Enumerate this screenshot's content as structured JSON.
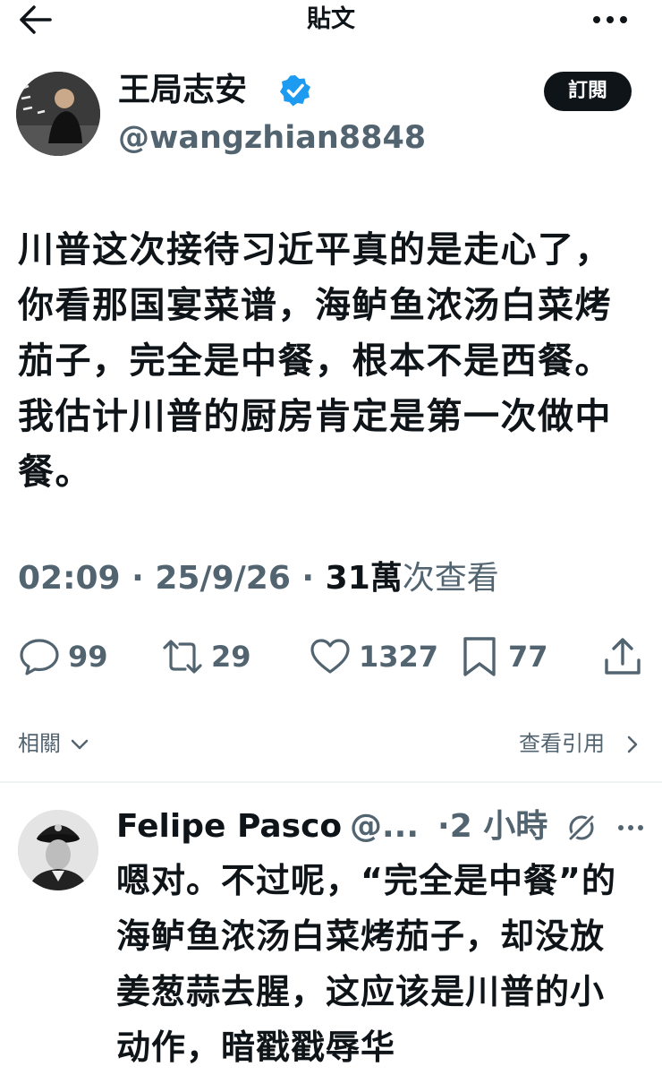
{
  "header": {
    "title": "貼文"
  },
  "post": {
    "author_name": "王局志安",
    "author_handle": "@wangzhian8848",
    "subscribe_label": "訂閱",
    "text": "川普这次接待习近平真的是走心了，你看那国宴菜谱，海鲈鱼浓汤白菜烤茄子，完全是中餐，根本不是西餐。我估计川普的厨房肯定是第一次做中餐。",
    "time": "02:09",
    "date": "25/9/26",
    "views_count": "31萬",
    "views_label": "次查看",
    "replies": "99",
    "reposts": "29",
    "likes": "1327",
    "bookmarks": "77"
  },
  "related": {
    "label": "相關",
    "quotes_link": "查看引用"
  },
  "reply": {
    "name": "Felipe Pasco",
    "handle": "@...",
    "time": "2 小時",
    "text": "嗯对。不过呢，“完全是中餐”的海鲈鱼浓汤白菜烤茄子，却没放姜葱蒜去腥，这应该是川普的小动作，暗戳戳辱华"
  },
  "colors": {
    "text": "#0f1419",
    "secondary": "#536471",
    "verified": "#1d9bf0",
    "divider": "#eff3f4"
  }
}
